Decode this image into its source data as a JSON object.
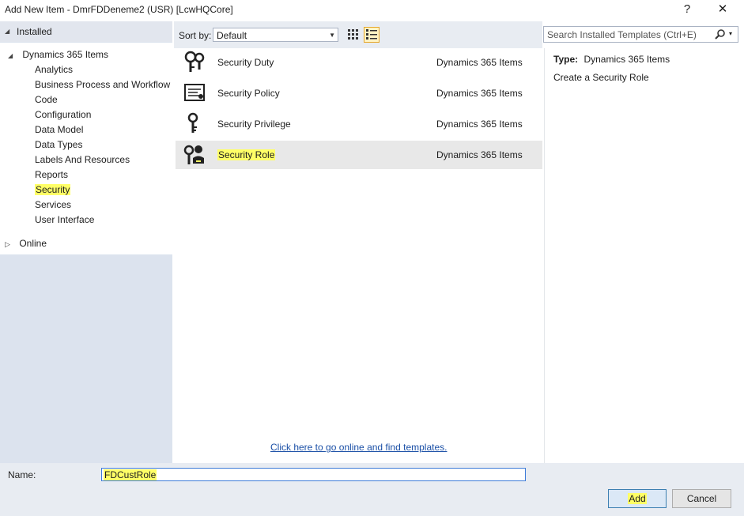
{
  "window": {
    "title": "Add New Item - DmrFDDeneme2 (USR) [LcwHQCore]",
    "help_label": "?",
    "close_label": "✕"
  },
  "left": {
    "installed_label": "Installed",
    "root_label": "Dynamics 365 Items",
    "children": [
      "Analytics",
      "Business Process and Workflow",
      "Code",
      "Configuration",
      "Data Model",
      "Data Types",
      "Labels And Resources",
      "Reports",
      "Security",
      "Services",
      "User Interface"
    ],
    "selected_child": "Security",
    "online_label": "Online"
  },
  "toolbar": {
    "sort_label": "Sort by:",
    "sort_value": "Default"
  },
  "templates": [
    {
      "name": "Security Duty",
      "category": "Dynamics 365 Items",
      "icon": "security-duty-icon",
      "selected": false
    },
    {
      "name": "Security Policy",
      "category": "Dynamics 365 Items",
      "icon": "security-policy-icon",
      "selected": false
    },
    {
      "name": "Security Privilege",
      "category": "Dynamics 365 Items",
      "icon": "security-privilege-icon",
      "selected": false
    },
    {
      "name": "Security Role",
      "category": "Dynamics 365 Items",
      "icon": "security-role-icon",
      "selected": true
    }
  ],
  "online_link": "Click here to go online and find templates.",
  "search": {
    "placeholder": "Search Installed Templates (Ctrl+E)"
  },
  "details": {
    "type_label": "Type:",
    "type_value": "Dynamics 365 Items",
    "description": "Create a Security Role"
  },
  "bottom": {
    "name_label": "Name:",
    "name_value": "FDCustRole",
    "add_label": "Add",
    "cancel_label": "Cancel"
  },
  "colors": {
    "highlight": "#ffff66",
    "link": "#1a4fa6",
    "pane_bg": "#dce3ee",
    "selection": "#e8e8e8"
  }
}
